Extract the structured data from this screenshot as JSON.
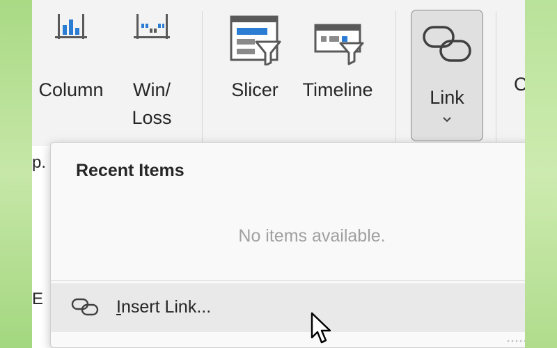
{
  "ribbon": {
    "column_label": "Column",
    "winloss_label_line1": "Win/",
    "winloss_label_line2": "Loss",
    "slicer_label": "Slicer",
    "timeline_label": "Timeline",
    "link_label": "Link",
    "cut_label": "C"
  },
  "left_strip": {
    "top_text": "p.",
    "bottom_text": "E"
  },
  "dropdown": {
    "title": "Recent Items",
    "empty_text": "No items available.",
    "insert_link": {
      "accelerator": "I",
      "rest": "nsert Link..."
    }
  },
  "colors": {
    "accent_blue": "#2b7cd3",
    "background": "#f3f3f3"
  },
  "icons": [
    "column-sparkline-icon",
    "winloss-sparkline-icon",
    "slicer-icon",
    "timeline-icon",
    "link-icon",
    "chevron-down-icon",
    "insert-link-icon",
    "mouse-cursor-icon"
  ]
}
